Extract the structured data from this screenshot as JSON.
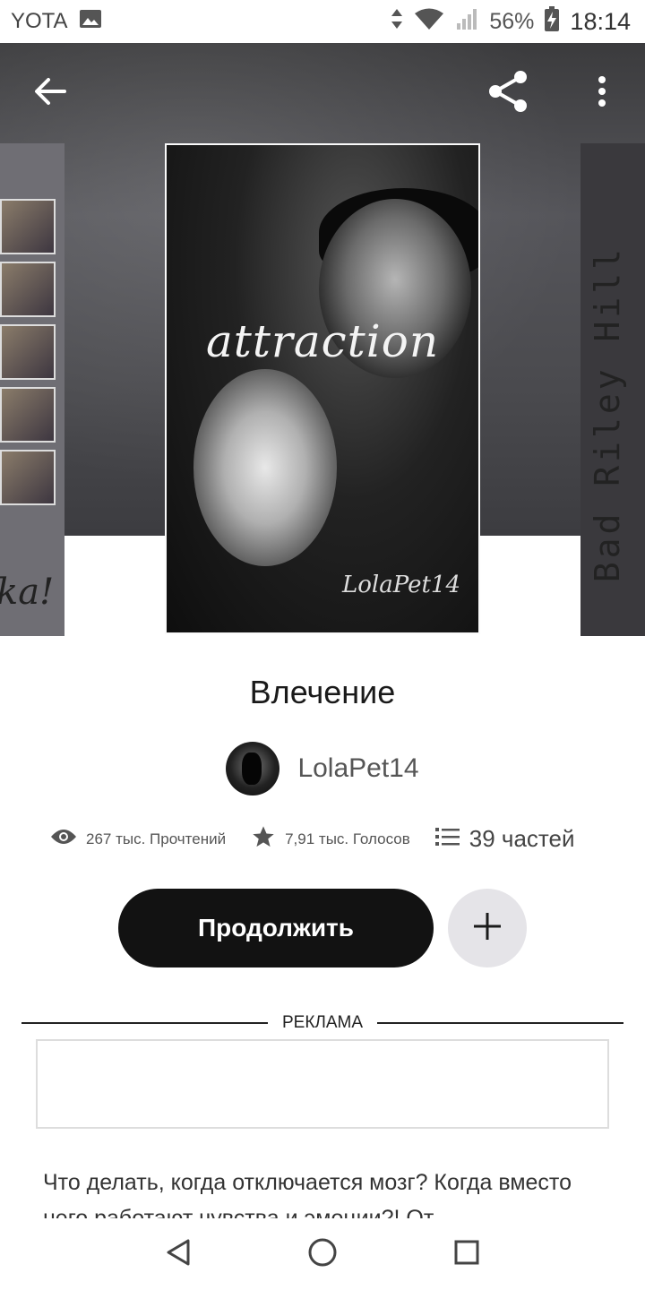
{
  "status_bar": {
    "carrier": "YOTA",
    "battery_percent": "56%",
    "time": "18:14"
  },
  "header": {
    "back_icon": "arrow-left-icon",
    "share_icon": "share-icon",
    "more_icon": "more-vertical-icon"
  },
  "covers": {
    "main": {
      "title_art": "attraction",
      "author_art": "LolaPet14"
    },
    "left_fragment": "ka!",
    "right_vertical_text": "Bad Riley Hill"
  },
  "book": {
    "title": "Влечение",
    "author": "LolaPet14",
    "reads": "267 тыс. Прочтений",
    "votes": "7,91 тыс. Голосов",
    "parts": "39 частей"
  },
  "actions": {
    "continue_label": "Продолжить",
    "add_icon": "plus-icon"
  },
  "ad": {
    "label": "РЕКЛАМА"
  },
  "description": "Что делать, когда отключается мозг? Когда вместо него работают чувства и эмоции?! От",
  "nav": {
    "back": "triangle-back-icon",
    "home": "circle-home-icon",
    "recents": "square-recents-icon"
  },
  "colors": {
    "accent_dark": "#121212",
    "add_button_bg": "#e5e4e8",
    "hero_bg": "#4a4a4e"
  }
}
